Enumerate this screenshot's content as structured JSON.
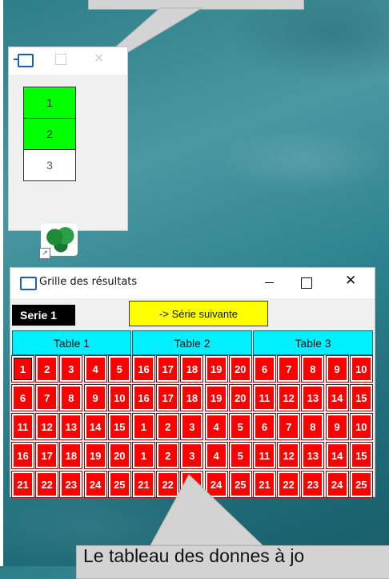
{
  "callouts": {
    "bottom_text": "Le tableau des donnes à jo"
  },
  "small_window": {
    "tiles": [
      {
        "label": "1",
        "state": "green"
      },
      {
        "label": "2",
        "state": "green"
      },
      {
        "label": "3",
        "state": "white"
      }
    ]
  },
  "results_window": {
    "title": "Grille des résultats",
    "series_label": "Serie 1",
    "next_button": "-> Série suivante",
    "tables": [
      "Table 1",
      "Table 2",
      "Table 3"
    ],
    "grid": [
      [
        "1",
        "2",
        "3",
        "4",
        "5",
        "16",
        "17",
        "18",
        "19",
        "20",
        "6",
        "7",
        "8",
        "9",
        "10"
      ],
      [
        "6",
        "7",
        "8",
        "9",
        "10",
        "16",
        "17",
        "18",
        "19",
        "20",
        "11",
        "12",
        "13",
        "14",
        "15"
      ],
      [
        "11",
        "12",
        "13",
        "14",
        "15",
        "1",
        "2",
        "3",
        "4",
        "5",
        "6",
        "7",
        "8",
        "9",
        "10"
      ],
      [
        "16",
        "17",
        "18",
        "19",
        "20",
        "1",
        "2",
        "3",
        "4",
        "5",
        "11",
        "12",
        "13",
        "14",
        "15"
      ],
      [
        "21",
        "22",
        "23",
        "24",
        "25",
        "21",
        "22",
        "23",
        "24",
        "25",
        "21",
        "22",
        "23",
        "24",
        "25"
      ]
    ],
    "cell_color": "#ff0000",
    "header_color": "#00f0ff",
    "button_color": "#ffff00",
    "selected_cell": "1"
  },
  "icons": [
    "app-window-icon",
    "maximize-icon",
    "close-icon",
    "minimize-icon",
    "shortcut-tree-icon",
    "shortcut-arrow-icon"
  ]
}
